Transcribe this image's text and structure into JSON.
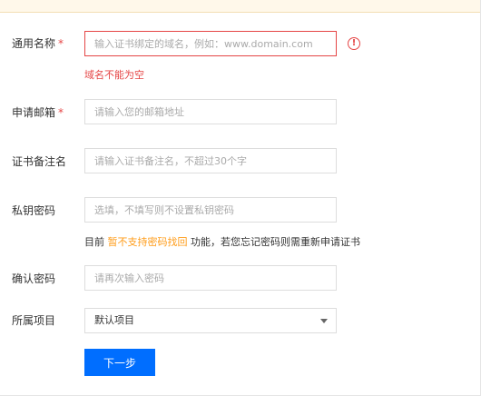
{
  "fields": {
    "common_name": {
      "label": "通用名称",
      "required_mark": "*",
      "placeholder": "输入证书绑定的域名，例如：www.domain.com",
      "value": "",
      "error_icon": "!",
      "error": "域名不能为空"
    },
    "email": {
      "label": "申请邮箱",
      "required_mark": "*",
      "placeholder": "请输入您的邮箱地址",
      "value": ""
    },
    "remark": {
      "label": "证书备注名",
      "placeholder": "请输入证书备注名，不超过30个字",
      "value": ""
    },
    "private_key_password": {
      "label": "私钥密码",
      "placeholder": "选填，不填写则不设置私钥密码",
      "value": "",
      "hint_prefix": "目前 ",
      "hint_warning": "暂不支持密码找回",
      "hint_suffix": " 功能，若您忘记密码则需重新申请证书"
    },
    "confirm_password": {
      "label": "确认密码",
      "placeholder": "请再次输入密码",
      "value": ""
    },
    "project": {
      "label": "所属项目",
      "selected": "默认项目"
    }
  },
  "actions": {
    "next_label": "下一步"
  },
  "colors": {
    "primary": "#006eff",
    "error": "#e54545",
    "warning": "#ff9c19"
  }
}
